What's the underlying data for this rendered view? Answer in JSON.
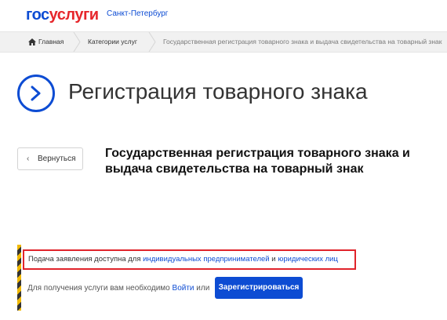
{
  "header": {
    "logo_part1": "гос",
    "logo_part2": "услуги",
    "city": "Санкт-Петербург"
  },
  "breadcrumb": {
    "home": "Главная",
    "category": "Категории услуг",
    "current": "Государственная регистрация товарного знака и выдача свидетельства на товарный знак"
  },
  "page": {
    "title": "Регистрация товарного знака",
    "back_label": "Вернуться",
    "service_title": "Государственная регистрация товарного знака и выдача свидетельства на товарный знак"
  },
  "notice": {
    "prefix": "Подача заявления доступна для ",
    "link1": "индивидуальных предпринимателей",
    "mid": " и ",
    "link2": "юридических лиц"
  },
  "login": {
    "prefix": "Для получения услуги вам необходимо ",
    "login_link": "Войти",
    "or": " или",
    "register_button": "Зарегистрироваться"
  },
  "colors": {
    "brand_blue": "#0d4cd3",
    "brand_red": "#e6262b",
    "notice_border": "#e0242b"
  },
  "icons": {
    "home": "home-icon",
    "title": "chevron-right-circle-icon",
    "back": "chevron-left-icon"
  }
}
